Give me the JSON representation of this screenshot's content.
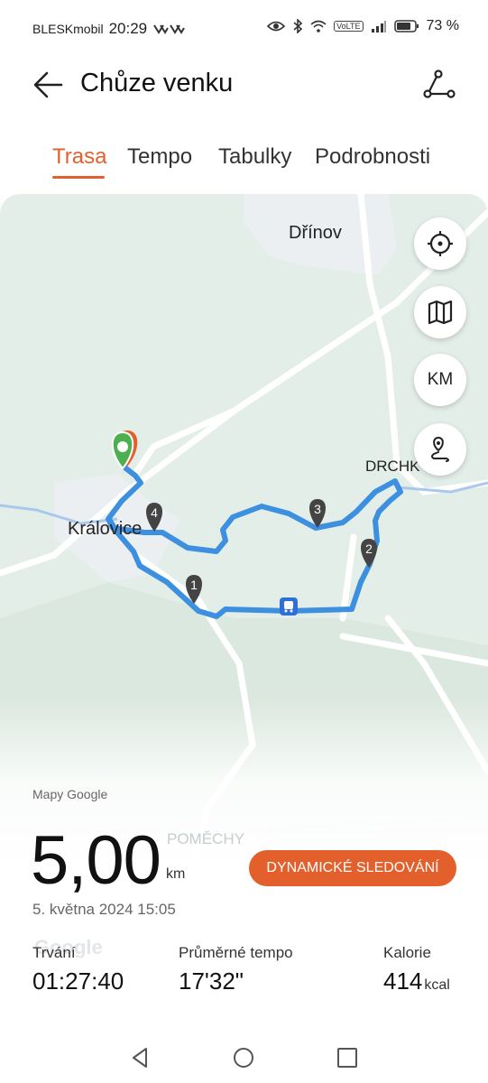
{
  "status_bar": {
    "carrier": "BLESKmobil",
    "time": "20:29",
    "volte": "VoLTE",
    "battery_percent": "73 %"
  },
  "header": {
    "title": "Chůze venku"
  },
  "tabs": [
    {
      "label": "Trasa",
      "active": true
    },
    {
      "label": "Tempo",
      "active": false
    },
    {
      "label": "Tabulky",
      "active": false
    },
    {
      "label": "Podrobnosti",
      "active": false
    }
  ],
  "map": {
    "places": {
      "drinov": "Dřínov",
      "kralovice": "Královice",
      "drchkov": "DRCHK",
      "pomechy": "POMĚCHY"
    },
    "fab_km_label": "KM",
    "markers": [
      "1",
      "2",
      "3",
      "4"
    ],
    "provider": "Mapy Google",
    "watermark": "Google",
    "route_color": "#3d8fe0"
  },
  "summary": {
    "distance": "5,00",
    "distance_unit": "km",
    "dynamic_tracking_button": "DYNAMICKÉ SLEDOVÁNÍ",
    "datetime": "5. května 2024 15:05",
    "duration_label": "Trvání",
    "duration_value": "01:27:40",
    "pace_label": "Průměrné tempo",
    "pace_value": "17'32\"",
    "calories_label": "Kalorie",
    "calories_value": "414",
    "calories_unit": "kcal"
  },
  "colors": {
    "accent": "#e3602d",
    "route": "#3d8fe0",
    "start_marker": "#4caf50"
  }
}
